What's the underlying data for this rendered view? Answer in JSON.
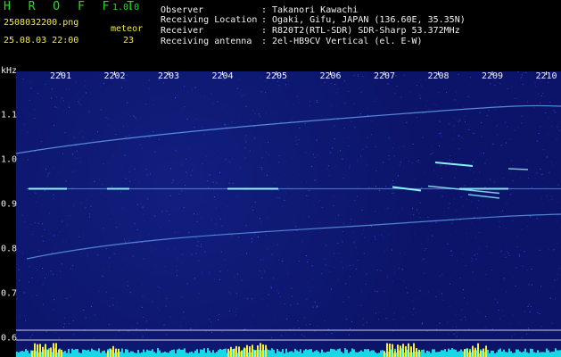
{
  "header": {
    "title": "H R O F F T",
    "version": "1.0.0",
    "filename": "2508032200.png",
    "datetime": "25.08.03 22:00",
    "meteor_label": "meteor",
    "meteor_count": "23"
  },
  "info": [
    {
      "label": "Observer",
      "value": "Takanori Kawachi"
    },
    {
      "label": "Receiving Location",
      "value": "Ogaki, Gifu, JAPAN (136.60E, 35.35N)"
    },
    {
      "label": "Receiver",
      "value": "R820T2(RTL-SDR) SDR-Sharp 53.372MHz"
    },
    {
      "label": "Receiving antenna",
      "value": "2el-HB9CV Vertical (el. E-W)"
    }
  ],
  "axis": {
    "y_unit": "kHz",
    "x_ticks": [
      "2201",
      "2202",
      "2203",
      "2204",
      "2205",
      "2206",
      "2207",
      "2208",
      "2209",
      "2210"
    ],
    "y_ticks": [
      "1.1",
      "1.0",
      "0.9",
      "0.8",
      "0.7",
      "0.6"
    ],
    "y_tick_values": [
      1.1,
      1.0,
      0.9,
      0.8,
      0.7,
      0.6
    ]
  },
  "colors": {
    "background": "#0b1468",
    "signal": "#6fb0ff",
    "meteor": "#8ff0ff",
    "strong": "#f3ec3a",
    "text_green": "#21e021",
    "text_yellow": "#f3ec3a"
  }
}
